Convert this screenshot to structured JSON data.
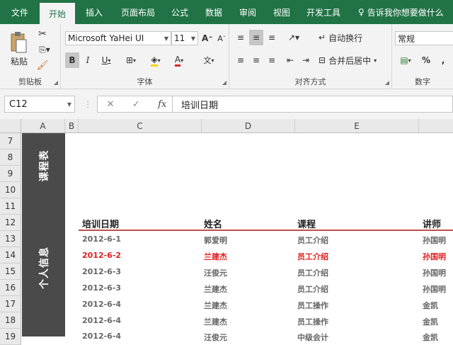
{
  "tabs": [
    {
      "label": "文件",
      "active": false
    },
    {
      "label": "开始",
      "active": true
    },
    {
      "label": "插入",
      "active": false
    },
    {
      "label": "页面布局",
      "active": false
    },
    {
      "label": "公式",
      "active": false
    },
    {
      "label": "数据",
      "active": false
    },
    {
      "label": "审阅",
      "active": false
    },
    {
      "label": "视图",
      "active": false
    },
    {
      "label": "开发工具",
      "active": false
    }
  ],
  "tell_me": "告诉我你想要做什么",
  "ribbon": {
    "clipboard": {
      "paste_label": "粘贴",
      "title": "剪贴板"
    },
    "font": {
      "name": "Microsoft YaHei UI",
      "size": "11",
      "title": "字体",
      "bold": "B",
      "italic": "I",
      "underline": "U",
      "grow": "A",
      "shrink": "A",
      "font_color": "A",
      "phonetic": "文"
    },
    "alignment": {
      "wrap_label": "自动换行",
      "merge_label": "合并后居中",
      "title": "对齐方式"
    },
    "number": {
      "format": "常规",
      "percent": "%",
      "comma": ",",
      "title": "数字"
    }
  },
  "formula_bar": {
    "name_box": "C12",
    "fx": "fx",
    "cancel": "✕",
    "enter": "✓",
    "content": "培训日期"
  },
  "columns": [
    "A",
    "B",
    "C",
    "D",
    "E"
  ],
  "rows": [
    "7",
    "8",
    "9",
    "10",
    "11",
    "12",
    "13",
    "14",
    "15",
    "16",
    "17",
    "18",
    "19"
  ],
  "side_labels": {
    "top": "课程表",
    "bottom": "个人信息"
  },
  "table": {
    "headers": [
      "培训日期",
      "姓名",
      "课程",
      "讲师"
    ],
    "rows": [
      {
        "date": "2012-6-1",
        "name": "郭爱明",
        "course": "员工介绍",
        "teacher": "孙国明",
        "highlight": false
      },
      {
        "date": "2012-6-2",
        "name": "兰建杰",
        "course": "员工介绍",
        "teacher": "孙国明",
        "highlight": true
      },
      {
        "date": "2012-6-3",
        "name": "汪俊元",
        "course": "员工介绍",
        "teacher": "孙国明",
        "highlight": false
      },
      {
        "date": "2012-6-3",
        "name": "兰建杰",
        "course": "员工介绍",
        "teacher": "孙国明",
        "highlight": false
      },
      {
        "date": "2012-6-4",
        "name": "兰建杰",
        "course": "员工操作",
        "teacher": "金凯",
        "highlight": false
      },
      {
        "date": "2012-6-4",
        "name": "兰建杰",
        "course": "员工操作",
        "teacher": "金凯",
        "highlight": false
      },
      {
        "date": "2012-6-4",
        "name": "汪俊元",
        "course": "中级会计",
        "teacher": "金凯",
        "highlight": false
      }
    ]
  },
  "colors": {
    "ribbon_green": "#217346",
    "sidebar": "#4a4a4a",
    "header_line": "#c0504d",
    "highlight": "#e02020"
  }
}
